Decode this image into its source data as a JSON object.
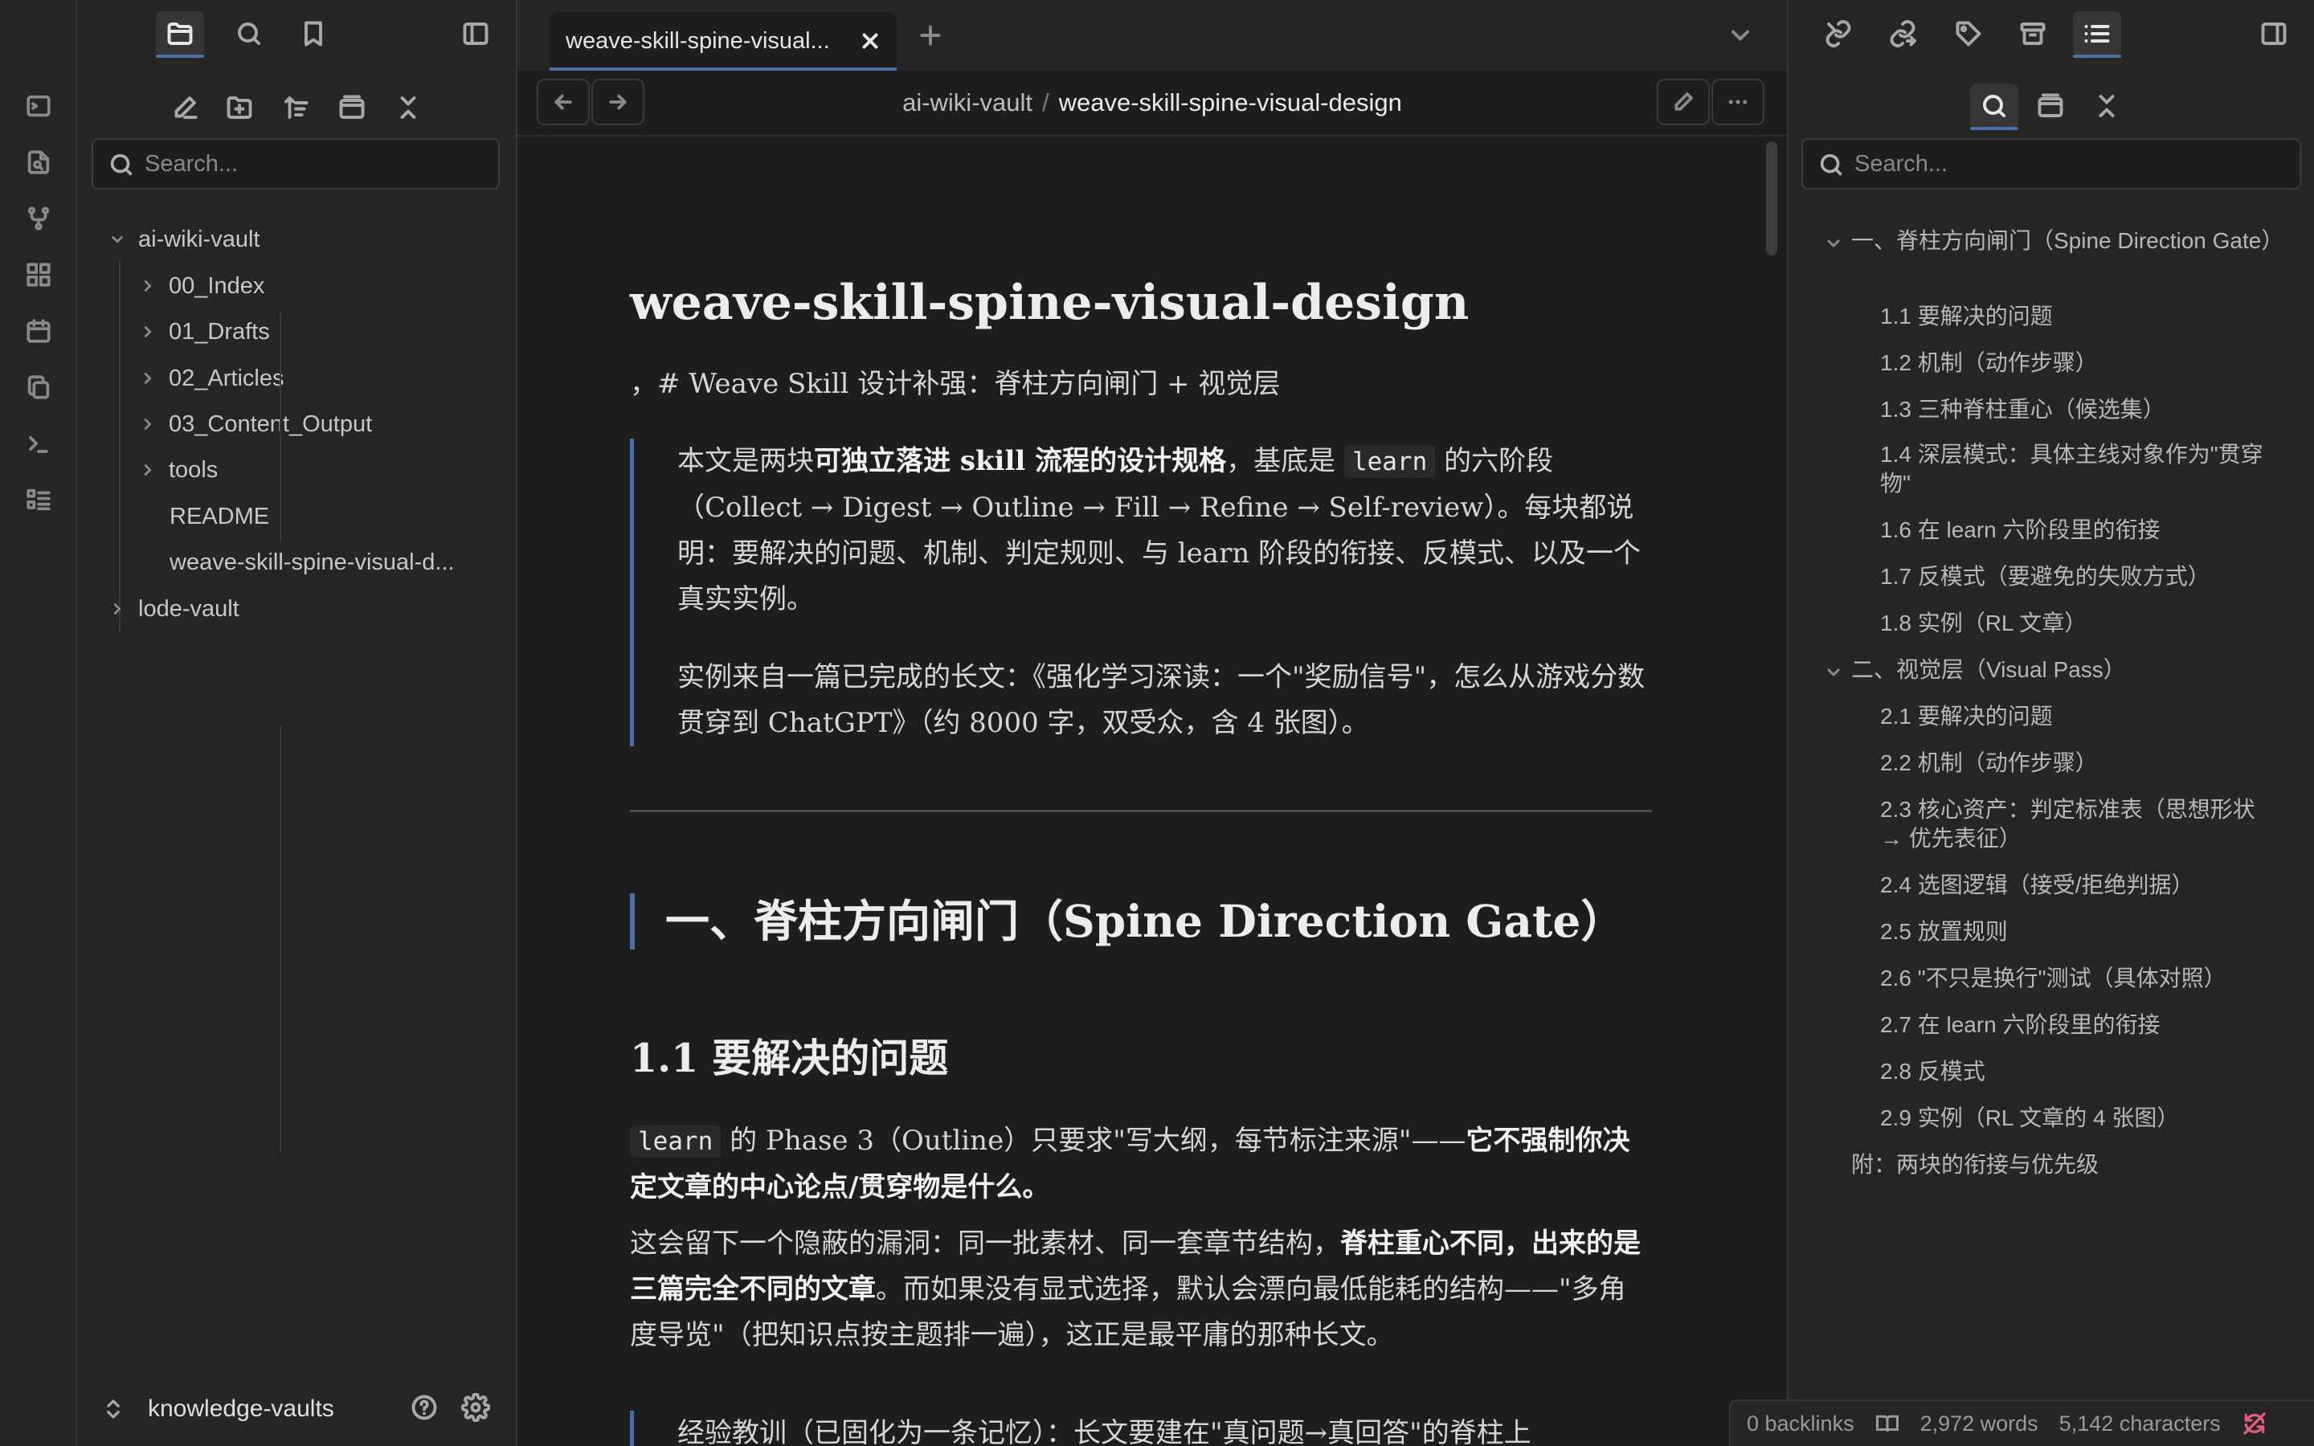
{
  "ribbon": {
    "icons": [
      "terminal-icon",
      "search-file-icon",
      "graph-icon",
      "dashboard-icon",
      "calendar-icon",
      "copy-icon",
      "command-prompt-icon",
      "list-icon"
    ]
  },
  "left_sidebar": {
    "search_placeholder": "Search...",
    "tree": {
      "root1": "ai-wiki-vault",
      "folders": [
        "00_Index",
        "01_Drafts",
        "02_Articles",
        "03_Content_Output",
        "tools"
      ],
      "files": [
        "README",
        "weave-skill-spine-visual-d..."
      ],
      "root2": "lode-vault"
    },
    "vault_name": "knowledge-vaults"
  },
  "editor": {
    "tab_title": "weave-skill-spine-visual...",
    "breadcrumb": {
      "vault": "ai-wiki-vault",
      "separator": "/",
      "current": "weave-skill-spine-visual-design"
    },
    "doc": {
      "title": "weave-skill-spine-visual-design",
      "subtitle_line": "，# Weave Skill 设计补强：脊柱方向闸门 + 视觉层",
      "quote_p1_a": "本文是两块",
      "quote_p1_bold": "可独立落进 skill 流程的设计规格",
      "quote_p1_b": "，基底是 ",
      "quote_p1_code": "learn",
      "quote_p1_c": " 的六阶段（Collect → Digest → Outline → Fill → Refine → Self-review）。每块都说明：要解决的问题、机制、判定规则、与 learn 阶段的衔接、反模式、以及一个真实实例。",
      "quote_p2": "实例来自一篇已完成的长文：《强化学习深读：一个\"奖励信号\"，怎么从游戏分数贯穿到 ChatGPT》（约 8000 字，双受众，含 4 张图）。",
      "section1_title": "一、脊柱方向闸门（Spine Direction Gate）",
      "sub11_title": "1.1 要解决的问题",
      "p3_code": "learn",
      "p3_a": " 的 Phase 3（Outline）只要求\"写大纲，每节标注来源\"——",
      "p3_bold": "它不强制你决定文章的中心论点/贯穿物是什么。",
      "p4_a": "这会留下一个隐蔽的漏洞：同一批素材、同一套章节结构，",
      "p4_bold": "脊柱重心不同，出来的是三篇完全不同的文章",
      "p4_b": "。而如果没有显式选择，默认会漂向最低能耗的结构——\"多角度导览\"（把知识点按主题排一遍），这正是最平庸的那种长文。",
      "p5_partial": "经验教训（已固化为一条记忆）：长文要建在\"真问题→真回答\"的脊柱上"
    }
  },
  "right_sidebar": {
    "search_placeholder": "Search...",
    "outline": [
      {
        "level": 1,
        "text": "一、脊柱方向闸门（Spine Direction Gate）"
      },
      {
        "level": 2,
        "text": "1.1 要解决的问题"
      },
      {
        "level": 2,
        "text": "1.2 机制（动作步骤）"
      },
      {
        "level": 2,
        "text": "1.3 三种脊柱重心（候选集）"
      },
      {
        "level": 2,
        "text": "1.4 深层模式：具体主线对象作为\"贯穿物\""
      },
      {
        "level": 2,
        "text": "1.6 在 learn 六阶段里的衔接"
      },
      {
        "level": 2,
        "text": "1.7 反模式（要避免的失败方式）"
      },
      {
        "level": 2,
        "text": "1.8 实例（RL 文章）"
      },
      {
        "level": 1,
        "text": "二、视觉层（Visual Pass）"
      },
      {
        "level": 2,
        "text": "2.1 要解决的问题"
      },
      {
        "level": 2,
        "text": "2.2 机制（动作步骤）"
      },
      {
        "level": 2,
        "text": "2.3 核心资产：判定标准表（思想形状 → 优先表征）"
      },
      {
        "level": 2,
        "text": "2.4 选图逻辑（接受/拒绝判据）"
      },
      {
        "level": 2,
        "text": "2.5 放置规则"
      },
      {
        "level": 2,
        "text": "2.6 \"不只是换行\"测试（具体对照）"
      },
      {
        "level": 2,
        "text": "2.7 在 learn 六阶段里的衔接"
      },
      {
        "level": 2,
        "text": "2.8 反模式"
      },
      {
        "level": 2,
        "text": "2.9 实例（RL 文章的 4 张图）"
      },
      {
        "level": 1,
        "text": "附：两块的衔接与优先级"
      }
    ]
  },
  "status_bar": {
    "backlinks": "0 backlinks",
    "words": "2,972 words",
    "characters": "5,142 characters"
  },
  "colors": {
    "accent": "#4a6fa5",
    "background": "#1e1e1e",
    "sidebar": "#262626",
    "sync_error": "#e0627a"
  }
}
